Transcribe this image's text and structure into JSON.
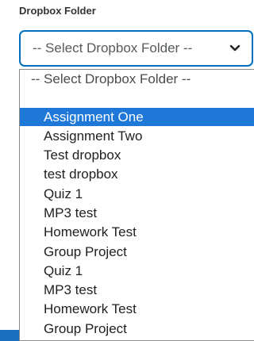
{
  "field": {
    "label": "Dropbox Folder",
    "selected_value": "-- Select Dropbox Folder --"
  },
  "dropdown": {
    "options": [
      {
        "label": "-- Select Dropbox Folder --"
      },
      {
        "label": ""
      },
      {
        "label": "Assignment One",
        "highlighted": true
      },
      {
        "label": "Assignment Two"
      },
      {
        "label": "Test dropbox"
      },
      {
        "label": "test dropbox"
      },
      {
        "label": "Quiz 1"
      },
      {
        "label": "MP3 test"
      },
      {
        "label": "Homework Test"
      },
      {
        "label": "Group Project"
      },
      {
        "label": "Quiz 1"
      },
      {
        "label": "MP3 test"
      },
      {
        "label": "Homework Test"
      },
      {
        "label": "Group Project"
      }
    ]
  },
  "colors": {
    "focus_border": "#006fbf",
    "highlight": "#1e78d8"
  },
  "icons": {
    "select_arrow": "chevron-down-icon"
  }
}
